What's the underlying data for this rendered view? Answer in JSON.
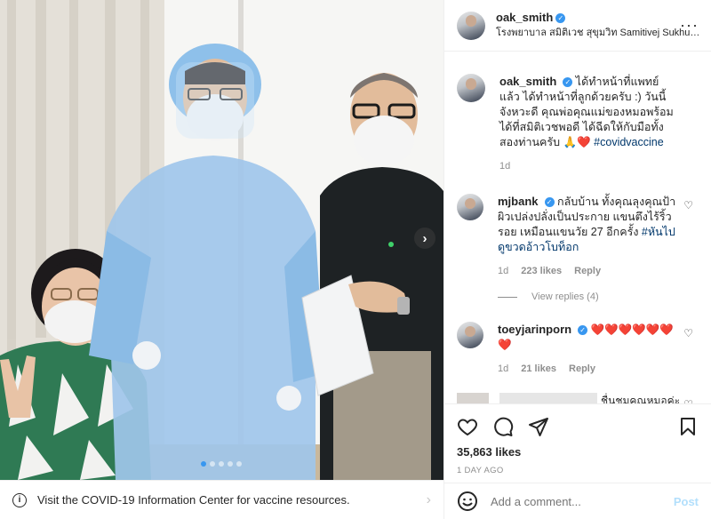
{
  "post": {
    "username": "oak_smith",
    "location": "โรงพยาบาล สมิติเวช สุขุมวิท Samitivej Sukhumvit Hospital",
    "more_icon": "more-horizontal-icon"
  },
  "banner": {
    "text": "Visit the COVID-19 Information Center for vaccine resources.",
    "icon": "info-icon"
  },
  "caption": {
    "username": "oak_smith",
    "text": "ได้ทำหน้าที่แพทย์แล้ว ได้ทำหน้าที่ลูกด้วยครับ :) วันนี้จังหวะดี คุณพ่อคุณแม่ของหมอพร้อมได้ที่สมิติเวชพอดี ได้ฉีดให้กับมือทั้งสองท่านครับ",
    "emoji": "🙏❤️",
    "hashtag": "#covidvaccine",
    "time": "1d"
  },
  "comments": [
    {
      "username": "mjbank",
      "text": "กลับบ้าน ทั้งคุณลุงคุณป้า ผิวเปล่งปลั่งเป็นประกาย แขนตึงไร้ริ้วรอย เหมือนแขนวัย 27 อีกครั้ง",
      "hashtag": "#หันไปดูขวดอ้าวโบท็อก",
      "time": "1d",
      "likes": "223 likes",
      "reply": "Reply",
      "view_replies": "View replies (4)"
    },
    {
      "username": "toeyjarinporn",
      "text": "❤️❤️❤️❤️❤️❤️❤️",
      "time": "1d",
      "likes": "21 likes",
      "reply": "Reply"
    },
    {
      "partial_text": "ชื่นชมคุณหมอค่ะ"
    }
  ],
  "actions": {
    "likes": "35,863 likes",
    "date": "1 DAY AGO"
  },
  "add_comment": {
    "placeholder": "Add a comment...",
    "post_label": "Post"
  },
  "carousel": {
    "slide_count": 5,
    "active_index": 0
  }
}
